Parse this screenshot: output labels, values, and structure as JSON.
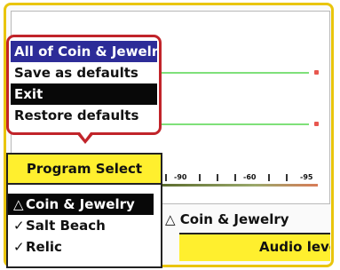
{
  "context_menu": {
    "items": [
      {
        "label": "All of Coin & Jewelry",
        "state": "highlighted"
      },
      {
        "label": "Save as defaults",
        "state": "normal"
      },
      {
        "label": "Exit",
        "state": "selected"
      },
      {
        "label": "Restore defaults",
        "state": "normal"
      }
    ]
  },
  "scale": {
    "ticks": [
      "-90",
      "-60",
      "-95"
    ]
  },
  "program_select": {
    "title": "Program Select",
    "items": [
      {
        "mark": "△",
        "label": "Coin & Jewelry",
        "current": true
      },
      {
        "mark": "✓",
        "label": "Salt Beach",
        "current": false
      },
      {
        "mark": "✓",
        "label": "Relic",
        "current": false
      }
    ]
  },
  "status": {
    "mode": "△ Coin & Jewelry",
    "audio_label": "Audio leve"
  },
  "colors": {
    "frame": "#e9c50c",
    "menu_border": "#c1242a",
    "highlight": "#2d2c98",
    "selected": "#080808",
    "panel_header": "#ffef2e",
    "grid_line": "#7fe07a"
  }
}
